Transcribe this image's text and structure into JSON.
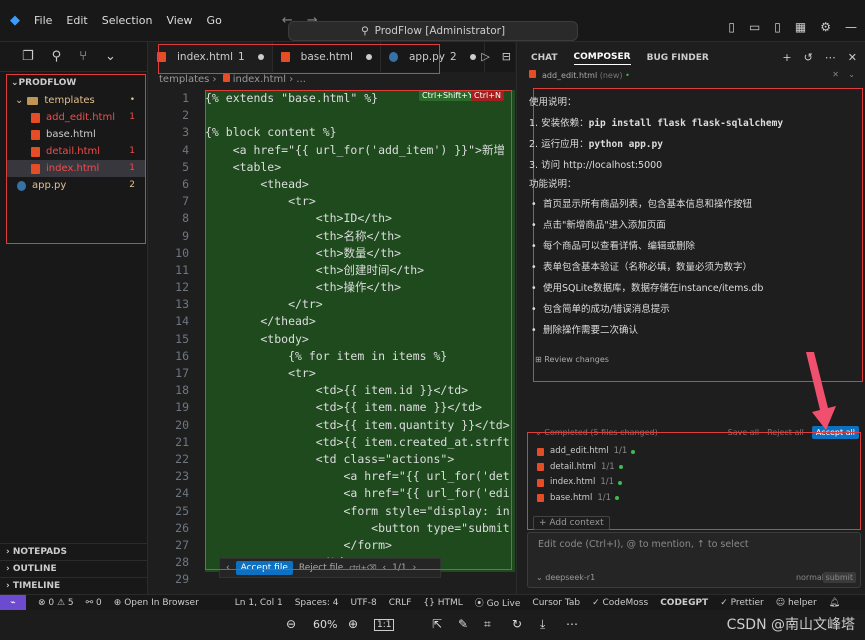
{
  "menu": [
    "File",
    "Edit",
    "Selection",
    "View",
    "Go"
  ],
  "command_center": "ProdFlow [Administrator]",
  "sidebar": {
    "root": "PRODFLOW",
    "items": [
      {
        "label": "templates",
        "badge": "•"
      },
      {
        "label": "add_edit.html",
        "badge": "1"
      },
      {
        "label": "base.html",
        "badge": ""
      },
      {
        "label": "detail.html",
        "badge": "1"
      },
      {
        "label": "index.html",
        "badge": "1"
      },
      {
        "label": "app.py",
        "badge": "2"
      }
    ],
    "sections": [
      "NOTEPADS",
      "OUTLINE",
      "TIMELINE"
    ]
  },
  "tabs": [
    {
      "label": "index.html",
      "badge": "1"
    },
    {
      "label": "base.html",
      "badge": ""
    },
    {
      "label": "app.py",
      "badge": "2"
    }
  ],
  "breadcrumb": [
    "templates",
    "index.html",
    "..."
  ],
  "hints": {
    "accept": "Ctrl+Shift+Y",
    "reject": "Ctrl+N"
  },
  "code_lines": [
    "{% extends \"base.html\" %}",
    "",
    "{% block content %}",
    "    <a href=\"{{ url_for('add_item') }}\">新增",
    "    <table>",
    "        <thead>",
    "            <tr>",
    "                <th>ID</th>",
    "                <th>名称</th>",
    "                <th>数量</th>",
    "                <th>创建时间</th>",
    "                <th>操作</th>",
    "            </tr>",
    "        </thead>",
    "        <tbody>",
    "            {% for item in items %}",
    "            <tr>",
    "                <td>{{ item.id }}</td>",
    "                <td>{{ item.name }}</td>",
    "                <td>{{ item.quantity }}</td>",
    "                <td>{{ item.created_at.strft",
    "                <td class=\"actions\">",
    "                    <a href=\"{{ url_for('det",
    "                    <a href=\"{{ url_for('edi",
    "                    <form style=\"display: in",
    "                        <button type=\"submit",
    "                    </form>",
    "                </td>",
    "            </tr>"
  ],
  "accept_bar": {
    "accept": "Accept file",
    "reject": "Reject file",
    "shortcut": "ctrl+⌫",
    "page": "1/1"
  },
  "chat": {
    "tabs": [
      "CHAT",
      "COMPOSER",
      "BUG FINDER"
    ],
    "context_file": "add_edit.html",
    "context_state": "(new)",
    "lines": [
      "使用说明：",
      "1. 安装依赖：",
      "2. 运行应用：",
      "3. 访问 http://localhost:5000",
      "功能说明："
    ],
    "cmd1": "pip install flask flask-sqlalchemy",
    "cmd2": "python app.py",
    "bullets": [
      "首页显示所有商品列表，包含基本信息和操作按钮",
      "点击\"新增商品\"进入添加页面",
      "每个商品可以查看详情、编辑或删除",
      "表单包含基本验证（名称必填，数量必须为数字）",
      "使用SQLite数据库，数据存储在instance/items.db",
      "包含简单的成功/错误消息提示",
      "删除操作需要二次确认"
    ],
    "review": "Review changes",
    "completed": "Completed (5 files changed)",
    "save_all": "Save all",
    "reject_all": "Reject all",
    "accept_all": "Accept all",
    "files": [
      {
        "name": "add_edit.html",
        "count": "1/1"
      },
      {
        "name": "detail.html",
        "count": "1/1"
      },
      {
        "name": "index.html",
        "count": "1/1"
      },
      {
        "name": "base.html",
        "count": "1/1"
      }
    ],
    "add_context": "+ Add context",
    "placeholder": "Edit code (Ctrl+I), @ to mention, ↑ to select",
    "model": "deepseek-r1",
    "mode": "normal",
    "submit": "submit"
  },
  "status": {
    "problems": "⊗ 0 ⚠ 5",
    "ports": "⚯ 0",
    "browser": "Open In Browser",
    "position": "Ln 1, Col 1",
    "spaces": "Spaces: 4",
    "encoding": "UTF-8",
    "eol": "CRLF",
    "lang": "HTML",
    "golive": "Go Live",
    "cursor": "Cursor Tab",
    "codemoss": "CodeMoss",
    "codegpt": "CODEGPT",
    "prettier": "Prettier",
    "helper": "helper"
  },
  "viewer": {
    "zoom": "60%",
    "scale": "1:1"
  },
  "watermark": "CSDN @南山文峰塔"
}
